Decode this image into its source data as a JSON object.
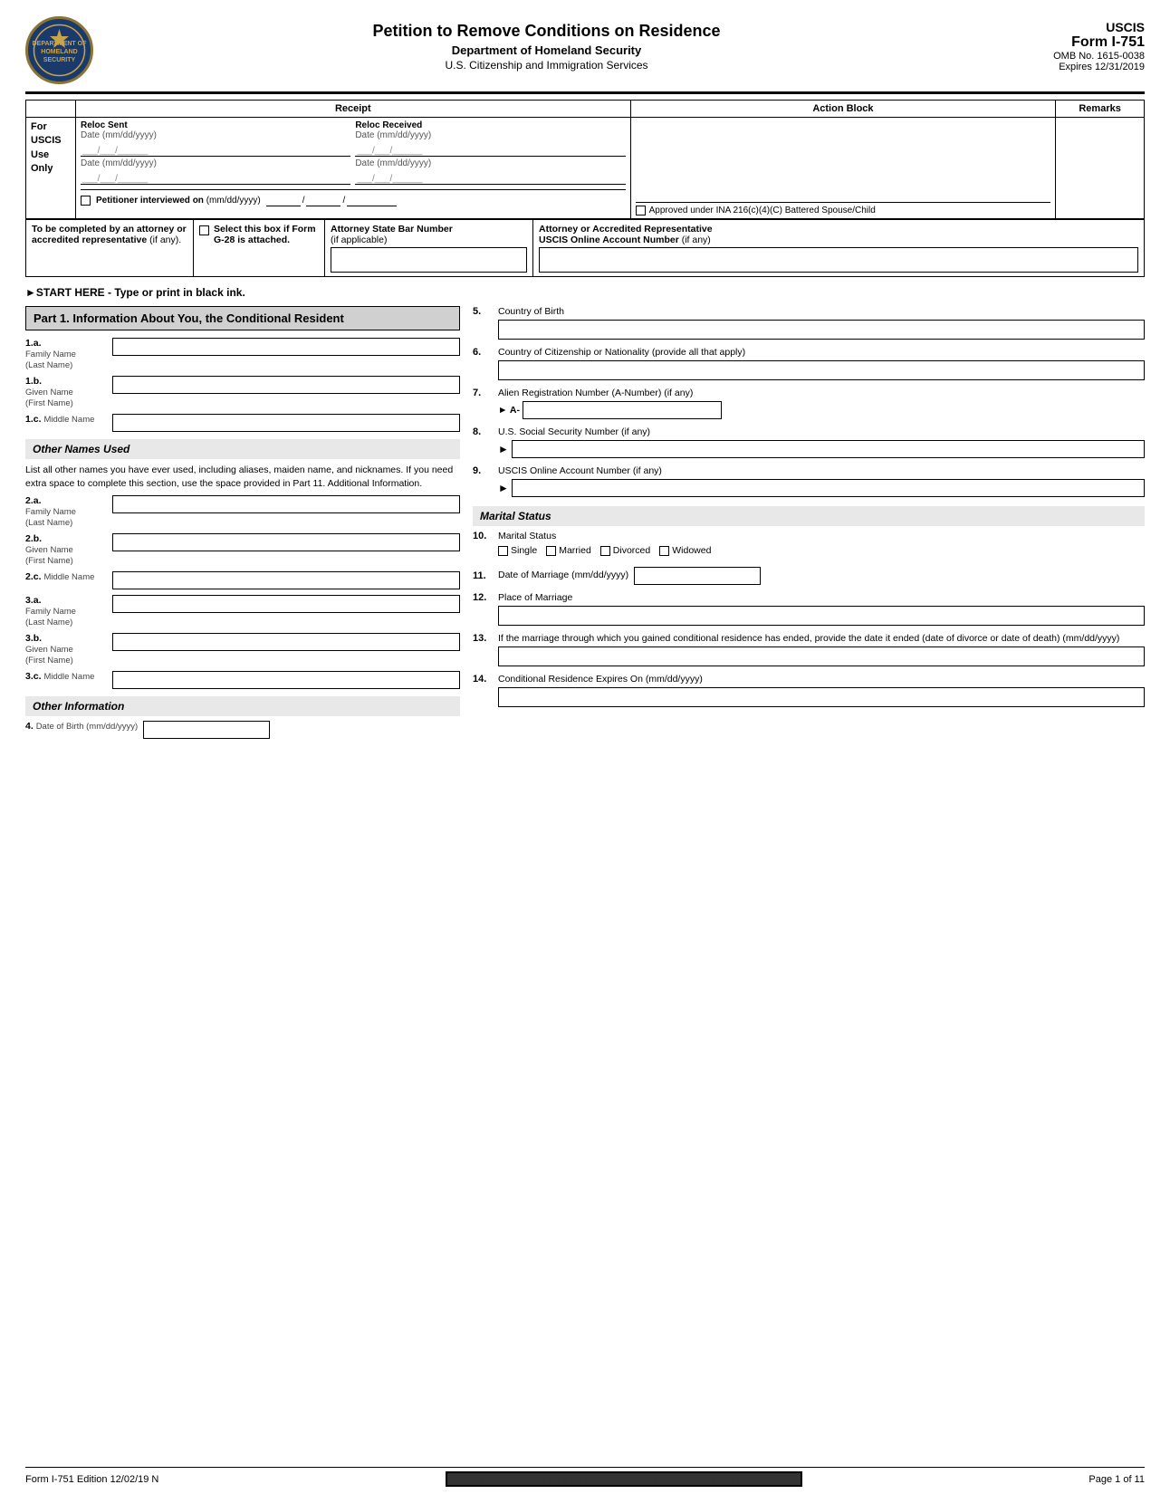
{
  "header": {
    "title": "Petition to Remove Conditions on Residence",
    "subtitle": "Department of Homeland Security",
    "sub2": "U.S. Citizenship and Immigration Services",
    "form_label": "USCIS",
    "form_number": "Form I-751",
    "omb": "OMB No. 1615-0038",
    "expires": "Expires 12/31/2019"
  },
  "top_table": {
    "receipt": "Receipt",
    "action_block": "Action Block",
    "remarks": "Remarks",
    "for_uscis": "For\nUSCIS\nUse\nOnly",
    "reloc_sent": "Reloc Sent",
    "reloc_received": "Reloc Received",
    "date_label": "Date (mm/dd/yyyy)",
    "petitioner_interviewed_on": "Petitioner interviewed on",
    "approved_under": "Approved under INA 216(c)(4)(C) Battered Spouse/Child"
  },
  "attorney_section": {
    "to_be_completed": "To be completed by an attorney or accredited representative (if any).",
    "select_box": "Select this box if Form G-28 is attached.",
    "attorney_bar_label": "Attorney State Bar Number",
    "attorney_bar_sub": "(if applicable)",
    "attorney_rep_label": "Attorney or Accredited Representative",
    "uscis_online_label": "USCIS Online Account Number (if any)"
  },
  "start_here": "►START HERE - Type or print in black ink.",
  "part1": {
    "heading": "Part 1.  Information About You, the Conditional Resident",
    "fields": [
      {
        "num": "1.a.",
        "label": "Family Name\n(Last Name)"
      },
      {
        "num": "1.b.",
        "label": "Given Name\n(First Name)"
      },
      {
        "num": "1.c.",
        "label": "Middle Name"
      }
    ],
    "other_names_heading": "Other Names Used",
    "other_names_text": "List all other names you have ever used, including aliases, maiden name, and nicknames.  If you need extra space to complete this section, use the space provided in Part 11. Additional Information.",
    "other_names_fields": [
      {
        "num": "2.a.",
        "label": "Family Name\n(Last Name)"
      },
      {
        "num": "2.b.",
        "label": "Given Name\n(First Name)"
      },
      {
        "num": "2.c.",
        "label": "Middle Name"
      },
      {
        "num": "3.a.",
        "label": "Family Name\n(Last Name)"
      },
      {
        "num": "3.b.",
        "label": "Given Name\n(First Name)"
      },
      {
        "num": "3.c.",
        "label": "Middle Name"
      }
    ],
    "other_info_heading": "Other Information",
    "field4_label": "Date of Birth (mm/dd/yyyy)",
    "field4_num": "4."
  },
  "right_col": {
    "field5_num": "5.",
    "field5_label": "Country of Birth",
    "field6_num": "6.",
    "field6_label": "Country of Citizenship or Nationality (provide all that apply)",
    "field7_num": "7.",
    "field7_label": "Alien Registration Number (A-Number) (if any)",
    "field7_prefix": "► A-",
    "field8_num": "8.",
    "field8_label": "U.S. Social Security Number (if any)",
    "field8_prefix": "►",
    "field9_num": "9.",
    "field9_label": "USCIS Online Account Number (if any)",
    "field9_prefix": "►",
    "marital_heading": "Marital Status",
    "field10_num": "10.",
    "field10_label": "Marital Status",
    "marital_options": [
      "Single",
      "Married",
      "Divorced",
      "Widowed"
    ],
    "field11_num": "11.",
    "field11_label": "Date of Marriage (mm/dd/yyyy)",
    "field12_num": "12.",
    "field12_label": "Place of Marriage",
    "field13_num": "13.",
    "field13_label": "If the marriage through which you gained conditional residence has ended, provide the date it ended (date of divorce or date of death) (mm/dd/yyyy)",
    "field14_num": "14.",
    "field14_label": "Conditional Residence Expires On (mm/dd/yyyy)"
  },
  "footer": {
    "form_label": "Form I-751",
    "edition_label": "Edition",
    "edition_date": "12/02/19 N",
    "page": "Page 1 of 11"
  }
}
